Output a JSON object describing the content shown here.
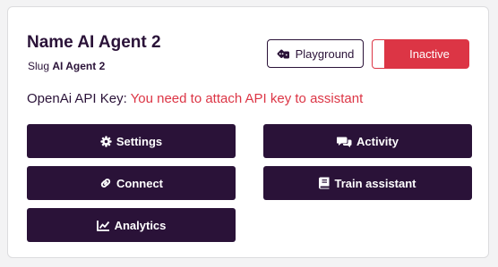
{
  "agent": {
    "title": "Name AI Agent 2",
    "slug_label": "Slug",
    "slug_value": "AI Agent 2"
  },
  "header": {
    "playground_label": "Playground",
    "status_label": "Inactive"
  },
  "apikey": {
    "label": "OpenAi API Key:",
    "message": "You need to attach API key to assistant"
  },
  "actions": {
    "settings": "Settings",
    "activity": "Activity",
    "connect": "Connect",
    "train": "Train assistant",
    "analytics": "Analytics"
  },
  "icons": {
    "playground": "dice-icon",
    "settings": "gear-icon",
    "activity": "comments-icon",
    "connect": "link-icon",
    "train": "book-icon",
    "analytics": "chart-line-icon"
  },
  "colors": {
    "primary": "#2a1238",
    "danger": "#dc3545",
    "background": "#f3f3f4"
  }
}
